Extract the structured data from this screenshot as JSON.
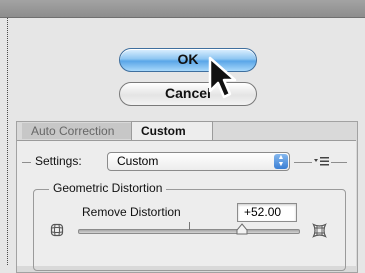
{
  "dialog": {
    "ok_label": "OK",
    "cancel_label": "Cancel"
  },
  "tabs": [
    {
      "label": "Auto Correction",
      "active": false
    },
    {
      "label": "Custom",
      "active": true
    }
  ],
  "settings": {
    "label": "Settings:",
    "selected": "Custom",
    "menu_icon": "list-menu-icon"
  },
  "geometric_distortion": {
    "title": "Geometric Distortion",
    "remove_distortion": {
      "label": "Remove Distortion",
      "value": "+52.00",
      "slider_position": 0.74
    }
  },
  "icons": [
    "pointer-cursor-icon",
    "barrel-distortion-icon",
    "pincushion-distortion-icon",
    "popup-arrows-icon"
  ],
  "colors": {
    "ok_button": "#5aa6e8",
    "select_arrows": "#3b7fd4"
  }
}
